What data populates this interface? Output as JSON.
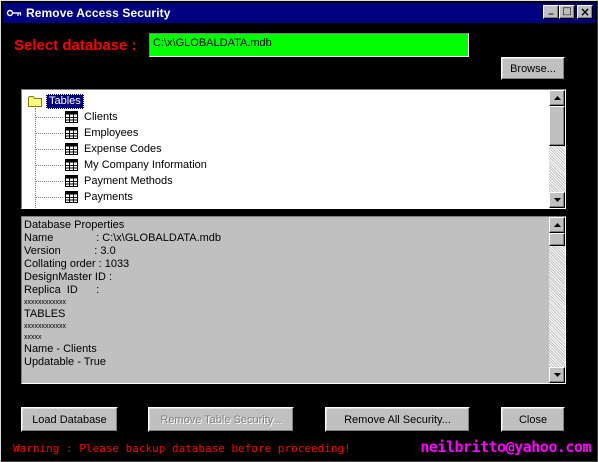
{
  "window": {
    "title": "Remove Access Security",
    "icon": "key-icon",
    "controls": {
      "minimize": "_",
      "maximize": "□",
      "close": "×"
    }
  },
  "database": {
    "label": "Select database :",
    "path": "C:\\x\\GLOBALDATA.mdb",
    "browse_label": "Browse..."
  },
  "tree": {
    "root_label": "Tables",
    "items": [
      {
        "label": "Clients"
      },
      {
        "label": "Employees"
      },
      {
        "label": "Expense Codes"
      },
      {
        "label": "My Company Information"
      },
      {
        "label": "Payment Methods"
      },
      {
        "label": "Payments"
      }
    ]
  },
  "properties": {
    "lines": [
      "Database Properties",
      "Name              : C:\\x\\GLOBALDATA.mdb",
      "Version           : 3.0",
      "Collating order : 1033",
      "DesignMaster ID :",
      "Replica  ID      :",
      "xxxxxxxxxxxx",
      "TABLES",
      "xxxxxxxxxxxx",
      "xxxxx",
      "Name - Clients",
      "Updatable - True"
    ]
  },
  "buttons": {
    "load": "Load Database",
    "remove_table": "Remove Table Security...",
    "remove_all": "Remove All Security...",
    "close": "Close"
  },
  "footer": {
    "warning": "Warning : Please backup database before proceeding!",
    "email": "neilbritto@yahoo.com"
  },
  "colors": {
    "background": "#000000",
    "title_bar": "#000080",
    "label_red": "#ff0000",
    "path_field": "#00ff00",
    "email_magenta": "#ff00ff"
  }
}
